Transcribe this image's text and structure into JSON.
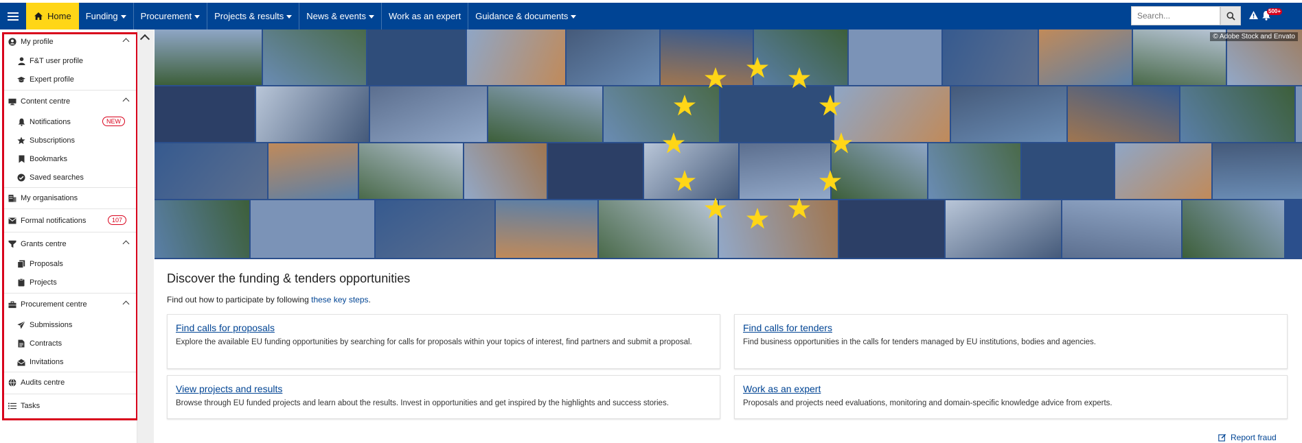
{
  "topbar": {
    "nav": [
      {
        "label": "Home"
      },
      {
        "label": "Funding"
      },
      {
        "label": "Procurement"
      },
      {
        "label": "Projects & results"
      },
      {
        "label": "News & events"
      },
      {
        "label": "Work as an expert"
      },
      {
        "label": "Guidance & documents"
      }
    ],
    "search_placeholder": "Search...",
    "notification_badge": "500+"
  },
  "sidebar": {
    "sections": {
      "my_profile": "My profile",
      "ft_user_profile": "F&T user profile",
      "expert_profile": "Expert profile",
      "content_centre": "Content centre",
      "notifications": "Notifications",
      "notifications_badge": "NEW",
      "subscriptions": "Subscriptions",
      "bookmarks": "Bookmarks",
      "saved_searches": "Saved searches",
      "my_organisations": "My organisations",
      "formal_notifications": "Formal notifications",
      "formal_notifications_count": "107",
      "grants_centre": "Grants centre",
      "proposals": "Proposals",
      "projects": "Projects",
      "procurement_centre": "Procurement centre",
      "submissions": "Submissions",
      "contracts": "Contracts",
      "invitations": "Invitations",
      "audits_centre": "Audits centre",
      "tasks": "Tasks"
    }
  },
  "hero": {
    "credit": "© Adobe Stock and Envato"
  },
  "main": {
    "title": "Discover the funding & tenders opportunities",
    "intro_before": "Find out how to participate by following ",
    "intro_link": "these key steps",
    "intro_after": ".",
    "cards": [
      {
        "title": "Find calls for proposals",
        "text": "Explore the available EU funding opportunities by searching for calls for proposals within your topics of interest, find partners and submit a proposal."
      },
      {
        "title": "Find calls for tenders",
        "text": "Find business opportunities in the calls for tenders managed by EU institutions, bodies and agencies."
      },
      {
        "title": "View projects and results",
        "text": "Browse through EU funded projects and learn about the results. Invest in opportunities and get inspired by the highlights and success stories."
      },
      {
        "title": "Work as an expert",
        "text": "Proposals and projects need evaluations, monitoring and domain-specific knowledge advice from experts."
      }
    ],
    "report_fraud": "Report fraud"
  },
  "colors": {
    "brand_blue": "#004494",
    "home_yellow": "#ffd617",
    "alert_red": "#d8001b",
    "star_yellow": "#ffd617"
  }
}
